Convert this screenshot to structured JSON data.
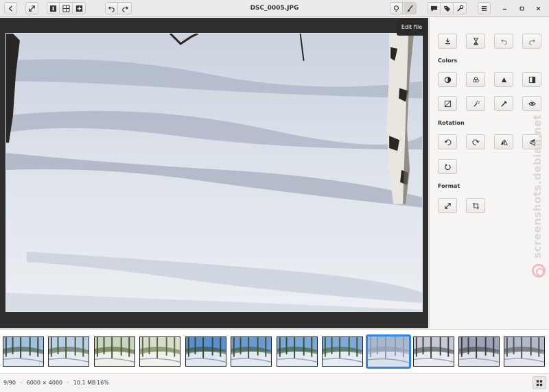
{
  "window": {
    "title": "DSC_0005.JPG"
  },
  "header": {
    "back_icon": "go-previous-icon",
    "fullscreen_icon": "fullscreen-icon",
    "view_single_icon": "view-single-icon",
    "view_grid_icon": "view-grid-icon",
    "view_add_icon": "add-icon",
    "undo_icon": "undo-icon",
    "redo_icon": "redo-icon",
    "bulb_icon": "lightbulb-icon",
    "edit_icon": "brush-icon",
    "comment_icon": "comment-icon",
    "tag_icon": "tag-icon",
    "tools_icon": "wrench-icon",
    "menu_icon": "hamburger-menu-icon",
    "minimize_icon": "minimize-icon",
    "maximize_icon": "maximize-icon",
    "close_icon": "close-icon"
  },
  "tooltip": {
    "text": "Edit file"
  },
  "panel": {
    "sections": {
      "colors": "Colors",
      "rotation": "Rotation",
      "format": "Format"
    }
  },
  "watermark": {
    "text": "screenshots.debian.net"
  },
  "thumbnails": {
    "count": 12,
    "selected_index": 8
  },
  "status": {
    "position": "9/90",
    "sep1": "·",
    "dimensions": "6000 × 4000",
    "sep2": "·",
    "filesize": "10.1 MB",
    "zoom": "16%"
  },
  "colors": {
    "accent": "#3584e4",
    "viewer_bg": "#2f2f2f",
    "panel_bg": "#f6f5f4"
  }
}
